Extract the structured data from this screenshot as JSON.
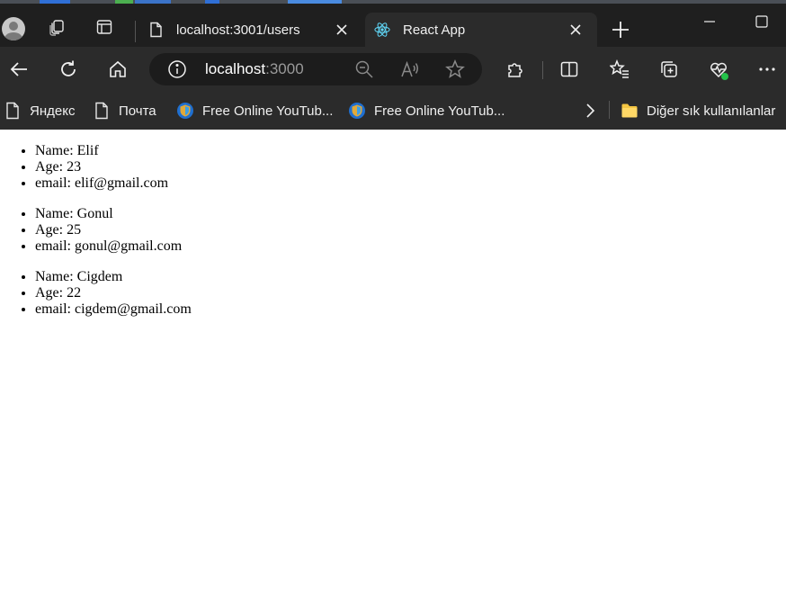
{
  "browser": {
    "tabs": [
      {
        "title": "localhost:3001/users",
        "active": false,
        "favicon": "page-icon"
      },
      {
        "title": "React App",
        "active": true,
        "favicon": "react-icon"
      }
    ],
    "address": {
      "host": "localhost",
      "port": ":3000"
    },
    "bookmarks": [
      {
        "label": "Яндекс",
        "icon": "page-icon"
      },
      {
        "label": "Почта",
        "icon": "page-icon"
      },
      {
        "label": "Free Online YouTub...",
        "icon": "shield-icon"
      },
      {
        "label": "Free Online YouTub...",
        "icon": "shield-icon"
      },
      {
        "label": "Diğer sık kullanılanlar",
        "icon": "folder-icon"
      }
    ],
    "colors": {
      "chrome": "#2b2b2b",
      "tabstrip": "#1f1f1f",
      "omnibox": "#1c1c1c",
      "folder": "#f4c542",
      "react": "#61dafb"
    }
  },
  "page": {
    "users": [
      {
        "name": "Name: Elif",
        "age": "Age: 23",
        "email": "email: elif@gmail.com"
      },
      {
        "name": "Name: Gonul",
        "age": "Age: 25",
        "email": "email: gonul@gmail.com"
      },
      {
        "name": "Name: Cigdem",
        "age": "Age: 22",
        "email": "email: cigdem@gmail.com"
      }
    ]
  }
}
